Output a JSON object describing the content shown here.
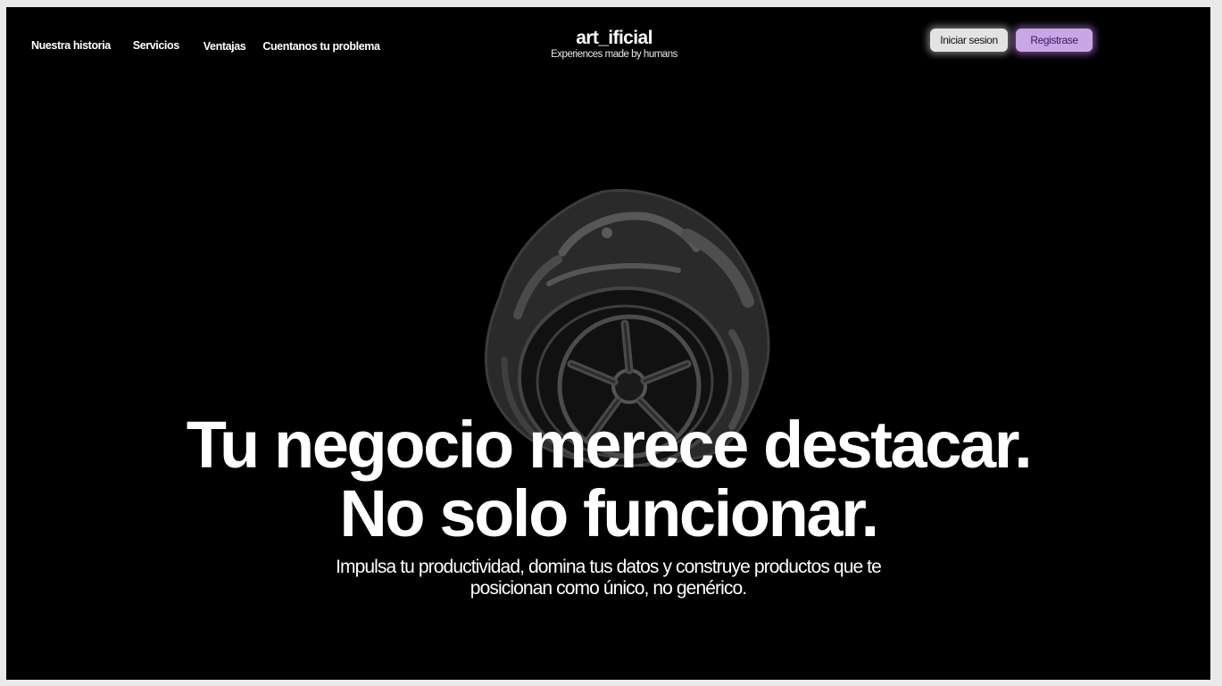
{
  "nav": {
    "items": [
      {
        "label": "Nuestra historia"
      },
      {
        "label": "Servicios"
      },
      {
        "label": "Ventajas"
      },
      {
        "label": "Cuentanos tu problema"
      }
    ]
  },
  "brand": {
    "name": "art_ificial",
    "tagline": "Experiences made by humans"
  },
  "auth": {
    "login_label": "Iniciar sesion",
    "register_label": "Registrase"
  },
  "hero": {
    "headline_line1": "Tu negocio merece destacar.",
    "headline_line2": "No solo funcionar.",
    "sub_line1": "Impulsa tu productividad, domina tus datos y construye productos que te",
    "sub_line2": "posicionan como único, no genérico."
  },
  "colors": {
    "background": "#000000",
    "frame_border": "#e9e9e9",
    "login_button": "#e3e3e3",
    "register_button": "#c9a6e6",
    "register_text": "#3b1763"
  },
  "icons": {
    "hero_graphic": "helmet-wheel-illustration"
  }
}
